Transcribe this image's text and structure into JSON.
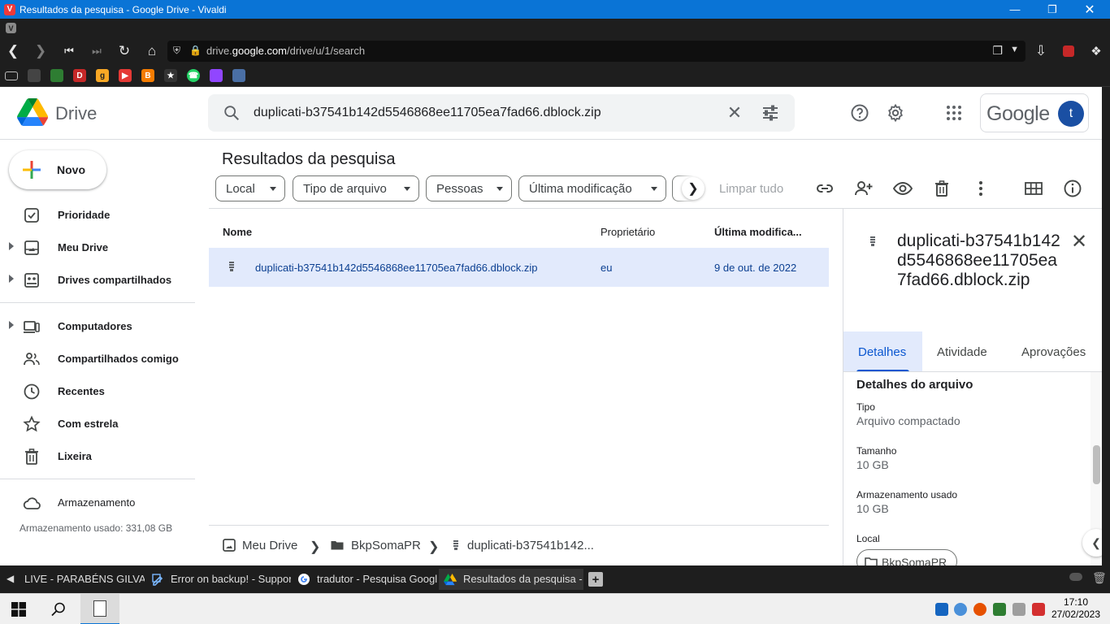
{
  "browser": {
    "window_title": "Resultados da pesquisa - Google Drive - Vivaldi",
    "url_prefix": "drive.",
    "url_domain": "google.com",
    "url_path": "/drive/u/1/search"
  },
  "drive": {
    "app_name": "Drive",
    "search_query": "duplicati-b37541b142d5546868ee11705ea7fad66.dblock.zip",
    "account_brand": "Google",
    "avatar_letter": "t"
  },
  "sidebar": {
    "new_label": "Novo",
    "items": [
      {
        "label": "Prioridade"
      },
      {
        "label": "Meu Drive"
      },
      {
        "label": "Drives compartilhados"
      },
      {
        "label": "Computadores"
      },
      {
        "label": "Compartilhados comigo"
      },
      {
        "label": "Recentes"
      },
      {
        "label": "Com estrela"
      },
      {
        "label": "Lixeira"
      },
      {
        "label": "Armazenamento"
      }
    ],
    "storage_used": "Armazenamento usado: 331,08 GB"
  },
  "main": {
    "title": "Resultados da pesquisa",
    "filters": [
      "Local",
      "Tipo de arquivo",
      "Pessoas",
      "Última modificação"
    ],
    "clear_all": "Limpar tudo",
    "columns": {
      "name": "Nome",
      "owner": "Proprietário",
      "modified": "Última modifica..."
    },
    "rows": [
      {
        "name": "duplicati-b37541b142d5546868ee11705ea7fad66.dblock.zip",
        "owner": "eu",
        "modified": "9 de out. de 2022"
      }
    ],
    "breadcrumb": [
      "Meu Drive",
      "BkpSomaPR",
      "duplicati-b37541b142..."
    ]
  },
  "details": {
    "title": "duplicati-b37541b142d5546868ee11705ea7fad66.dblock.zip",
    "tabs": [
      "Detalhes",
      "Atividade",
      "Aprovações"
    ],
    "section_title": "Detalhes do arquivo",
    "fields": [
      {
        "label": "Tipo",
        "value": "Arquivo compactado"
      },
      {
        "label": "Tamanho",
        "value": "10 GB"
      },
      {
        "label": "Armazenamento usado",
        "value": "10 GB"
      },
      {
        "label": "Local",
        "value": "BkpSomaPR"
      }
    ]
  },
  "tabs": [
    {
      "title": "LIVE - PARABÉNS GILVAN S"
    },
    {
      "title": "Error on backup! - Support"
    },
    {
      "title": "tradutor - Pesquisa Google"
    },
    {
      "title": "Resultados da pesquisa - G"
    }
  ],
  "taskbar": {
    "time": "17:10",
    "date": "27/02/2023"
  },
  "colors": {
    "accent_blue": "#0b57d0",
    "selected_row": "#e2eafc",
    "vivaldi_titlebar": "#0a74d6"
  }
}
